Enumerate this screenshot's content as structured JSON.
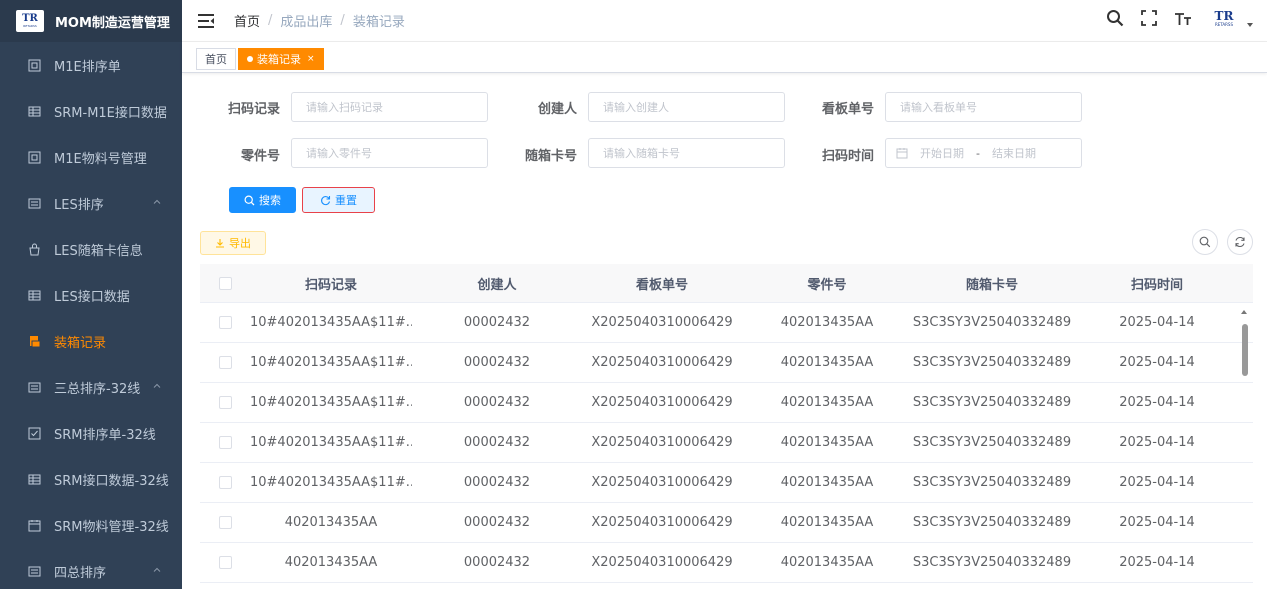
{
  "app": {
    "title": "MOM制造运营管理",
    "logo_text": "TR",
    "logo_sub": "RETARSS"
  },
  "sidebar": {
    "items": [
      {
        "label": "M1E排序单",
        "icon": "chip-icon"
      },
      {
        "label": "SRM-M1E接口数据",
        "icon": "table-icon"
      },
      {
        "label": "M1E物料号管理",
        "icon": "chip-icon"
      },
      {
        "label": "LES排序",
        "icon": "form-icon"
      },
      {
        "label": "LES随箱卡信息",
        "icon": "bag-icon"
      },
      {
        "label": "LES接口数据",
        "icon": "table-icon"
      },
      {
        "label": "装箱记录",
        "icon": "doc-icon"
      },
      {
        "label": "三总排序-32线",
        "icon": "form-icon"
      },
      {
        "label": "SRM排序单-32线",
        "icon": "checkbox-icon"
      },
      {
        "label": "SRM接口数据-32线",
        "icon": "table-icon"
      },
      {
        "label": "SRM物料管理-32线",
        "icon": "calendar-icon"
      },
      {
        "label": "四总排序",
        "icon": "form-icon"
      }
    ]
  },
  "breadcrumb": {
    "home": "首页",
    "level1": "成品出库",
    "current": "装箱记录"
  },
  "tags": {
    "home": "首页",
    "active": "装箱记录",
    "close": "×"
  },
  "form": {
    "scan_record": {
      "label": "扫码记录",
      "placeholder": "请输入扫码记录"
    },
    "creator": {
      "label": "创建人",
      "placeholder": "请输入创建人"
    },
    "kanban_no": {
      "label": "看板单号",
      "placeholder": "请输入看板单号"
    },
    "part_no": {
      "label": "零件号",
      "placeholder": "请输入零件号"
    },
    "card_no": {
      "label": "随箱卡号",
      "placeholder": "请输入随箱卡号"
    },
    "scan_time": {
      "label": "扫码时间",
      "start": "开始日期",
      "sep": "-",
      "end": "结束日期"
    }
  },
  "buttons": {
    "search": "搜索",
    "reset": "重置",
    "export": "导出"
  },
  "table": {
    "headers": [
      "扫码记录",
      "创建人",
      "看板单号",
      "零件号",
      "随箱卡号",
      "扫码时间"
    ],
    "rows": [
      [
        "10#402013435AA$11#...",
        "00002432",
        "X2025040310006429",
        "402013435AA",
        "S3C3SY3V25040332489",
        "2025-04-14"
      ],
      [
        "10#402013435AA$11#...",
        "00002432",
        "X2025040310006429",
        "402013435AA",
        "S3C3SY3V25040332489",
        "2025-04-14"
      ],
      [
        "10#402013435AA$11#...",
        "00002432",
        "X2025040310006429",
        "402013435AA",
        "S3C3SY3V25040332489",
        "2025-04-14"
      ],
      [
        "10#402013435AA$11#...",
        "00002432",
        "X2025040310006429",
        "402013435AA",
        "S3C3SY3V25040332489",
        "2025-04-14"
      ],
      [
        "10#402013435AA$11#...",
        "00002432",
        "X2025040310006429",
        "402013435AA",
        "S3C3SY3V25040332489",
        "2025-04-14"
      ],
      [
        "402013435AA",
        "00002432",
        "X2025040310006429",
        "402013435AA",
        "S3C3SY3V25040332489",
        "2025-04-14"
      ],
      [
        "402013435AA",
        "00002432",
        "X2025040310006429",
        "402013435AA",
        "S3C3SY3V25040332489",
        "2025-04-14"
      ]
    ]
  },
  "colors": {
    "sidebar_bg": "#304156",
    "accent": "#ff8a00",
    "primary": "#1890ff",
    "reset_border": "#e8424a"
  }
}
